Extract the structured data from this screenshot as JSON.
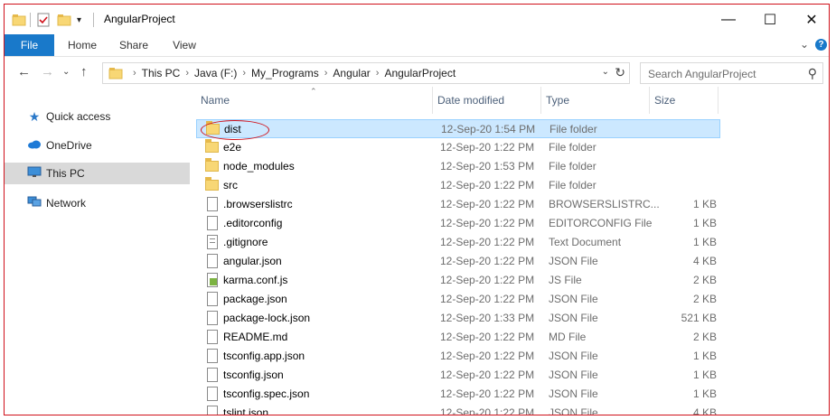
{
  "window": {
    "title": "AngularProject"
  },
  "ribbon": {
    "tabs": [
      "File",
      "Home",
      "Share",
      "View"
    ],
    "help": "?"
  },
  "address": {
    "crumbs": [
      "This PC",
      "Java (F:)",
      "My_Programs",
      "Angular",
      "AngularProject"
    ],
    "search_placeholder": "Search AngularProject"
  },
  "sidebar": {
    "items": [
      {
        "label": "Quick access",
        "icon": "star-icon"
      },
      {
        "label": "OneDrive",
        "icon": "cloud-icon"
      },
      {
        "label": "This PC",
        "icon": "monitor-icon"
      },
      {
        "label": "Network",
        "icon": "network-icon"
      }
    ]
  },
  "columns": {
    "name": "Name",
    "date": "Date modified",
    "type": "Type",
    "size": "Size"
  },
  "files": [
    {
      "name": "dist",
      "date": "12-Sep-20 1:54 PM",
      "type": "File folder",
      "size": "",
      "kind": "folder"
    },
    {
      "name": "e2e",
      "date": "12-Sep-20 1:22 PM",
      "type": "File folder",
      "size": "",
      "kind": "folder"
    },
    {
      "name": "node_modules",
      "date": "12-Sep-20 1:53 PM",
      "type": "File folder",
      "size": "",
      "kind": "folder"
    },
    {
      "name": "src",
      "date": "12-Sep-20 1:22 PM",
      "type": "File folder",
      "size": "",
      "kind": "folder"
    },
    {
      "name": ".browserslistrc",
      "date": "12-Sep-20 1:22 PM",
      "type": "BROWSERSLISTRC...",
      "size": "1 KB",
      "kind": "doc"
    },
    {
      "name": ".editorconfig",
      "date": "12-Sep-20 1:22 PM",
      "type": "EDITORCONFIG File",
      "size": "1 KB",
      "kind": "doc"
    },
    {
      "name": ".gitignore",
      "date": "12-Sep-20 1:22 PM",
      "type": "Text Document",
      "size": "1 KB",
      "kind": "text"
    },
    {
      "name": "angular.json",
      "date": "12-Sep-20 1:22 PM",
      "type": "JSON File",
      "size": "4 KB",
      "kind": "doc"
    },
    {
      "name": "karma.conf.js",
      "date": "12-Sep-20 1:22 PM",
      "type": "JS File",
      "size": "2 KB",
      "kind": "js"
    },
    {
      "name": "package.json",
      "date": "12-Sep-20 1:22 PM",
      "type": "JSON File",
      "size": "2 KB",
      "kind": "doc"
    },
    {
      "name": "package-lock.json",
      "date": "12-Sep-20 1:33 PM",
      "type": "JSON File",
      "size": "521 KB",
      "kind": "doc"
    },
    {
      "name": "README.md",
      "date": "12-Sep-20 1:22 PM",
      "type": "MD File",
      "size": "2 KB",
      "kind": "doc"
    },
    {
      "name": "tsconfig.app.json",
      "date": "12-Sep-20 1:22 PM",
      "type": "JSON File",
      "size": "1 KB",
      "kind": "doc"
    },
    {
      "name": "tsconfig.json",
      "date": "12-Sep-20 1:22 PM",
      "type": "JSON File",
      "size": "1 KB",
      "kind": "doc"
    },
    {
      "name": "tsconfig.spec.json",
      "date": "12-Sep-20 1:22 PM",
      "type": "JSON File",
      "size": "1 KB",
      "kind": "doc"
    },
    {
      "name": "tslint.json",
      "date": "12-Sep-20 1:22 PM",
      "type": "JSON File",
      "size": "4 KB",
      "kind": "doc"
    }
  ],
  "selected_index": 0
}
